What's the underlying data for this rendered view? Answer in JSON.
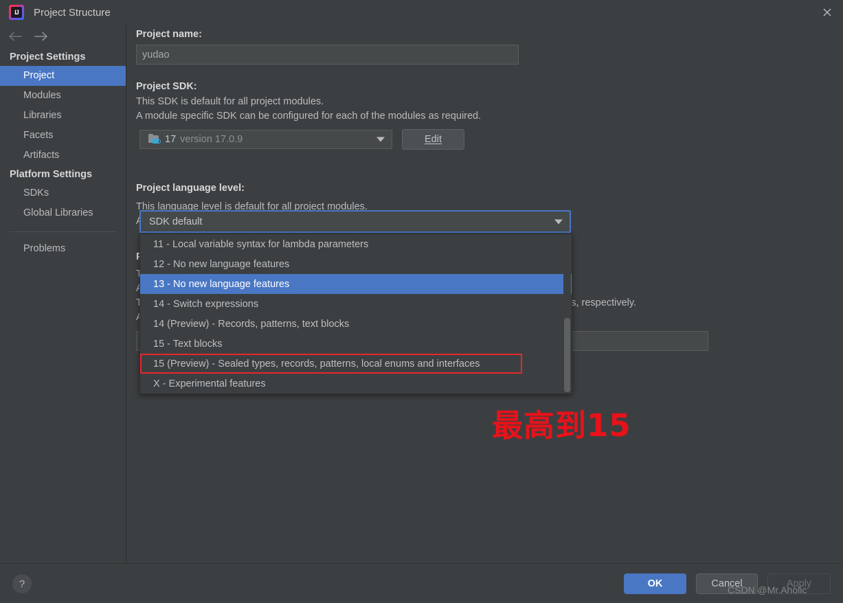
{
  "window": {
    "title": "Project Structure",
    "app_icon": "intellij-idea-icon",
    "close_icon": "close-icon"
  },
  "sidebar": {
    "back_icon": "arrow-left-icon",
    "forward_icon": "arrow-right-icon",
    "groups": [
      {
        "label": "Project Settings",
        "items": [
          {
            "label": "Project",
            "selected": true
          },
          {
            "label": "Modules",
            "selected": false
          },
          {
            "label": "Libraries",
            "selected": false
          },
          {
            "label": "Facets",
            "selected": false
          },
          {
            "label": "Artifacts",
            "selected": false
          }
        ]
      },
      {
        "label": "Platform Settings",
        "items": [
          {
            "label": "SDKs",
            "selected": false
          },
          {
            "label": "Global Libraries",
            "selected": false
          }
        ]
      }
    ],
    "problems_label": "Problems"
  },
  "main": {
    "project_name_label": "Project name:",
    "project_name_value": "yudao",
    "project_sdk_label": "Project SDK:",
    "project_sdk_desc_1": "This SDK is default for all project modules.",
    "project_sdk_desc_2": "A module specific SDK can be configured for each of the modules as required.",
    "sdk_icon": "java-sdk-folder-icon",
    "sdk_value_name": "17",
    "sdk_value_version": "version 17.0.9",
    "edit_button": "Edit",
    "language_level_label": "Project language level:",
    "language_level_desc_1": "This language level is default for all project modules.",
    "language_level_desc_2": "A module specific language level can be configured for each of the modules as required.",
    "language_level_value": "SDK default",
    "occluded": {
      "compiler_output_label": "Project compiler output:",
      "compiler_output_desc_1": "This path is used to store all project compilation results.",
      "compiler_output_desc_2": "A directory corresponding to each module is created under this path.",
      "compiler_output_desc_3": "This directory contains two subdirectories: Production and Test for production code and test sources, respectively.",
      "compiler_output_desc_4": "A module specific compiler output path can be configured for each of the modules as required.",
      "compiler_output_value": "",
      "browse_icon": "folder-browse-icon"
    }
  },
  "dropdown": {
    "options": [
      {
        "label": "11 - Local variable syntax for lambda parameters",
        "selected": false,
        "boxed": false
      },
      {
        "label": "12 - No new language features",
        "selected": false,
        "boxed": false
      },
      {
        "label": "13 - No new language features",
        "selected": true,
        "boxed": false
      },
      {
        "label": "14 - Switch expressions",
        "selected": false,
        "boxed": false
      },
      {
        "label": "14 (Preview) - Records, patterns, text blocks",
        "selected": false,
        "boxed": false
      },
      {
        "label": "15 - Text blocks",
        "selected": false,
        "boxed": false
      },
      {
        "label": "15 (Preview) - Sealed types, records, patterns, local enums and interfaces",
        "selected": false,
        "boxed": true
      },
      {
        "label": "X - Experimental features",
        "selected": false,
        "boxed": false
      }
    ],
    "scrollbar": "vertical-scrollbar"
  },
  "annotation": {
    "text": "最高到15"
  },
  "footer": {
    "help_icon": "help-icon",
    "ok_label": "OK",
    "cancel_label": "Cancel",
    "apply_label": "Apply"
  },
  "watermark": {
    "text": "CSDN @Mr.Aholic"
  },
  "colors": {
    "background": "#3c3f41",
    "accent_blue": "#4a77c4",
    "focus_border": "#4a78c8",
    "highlight_red": "#e5282a",
    "annotation_red": "#e8121a",
    "field_background": "#45494a"
  }
}
